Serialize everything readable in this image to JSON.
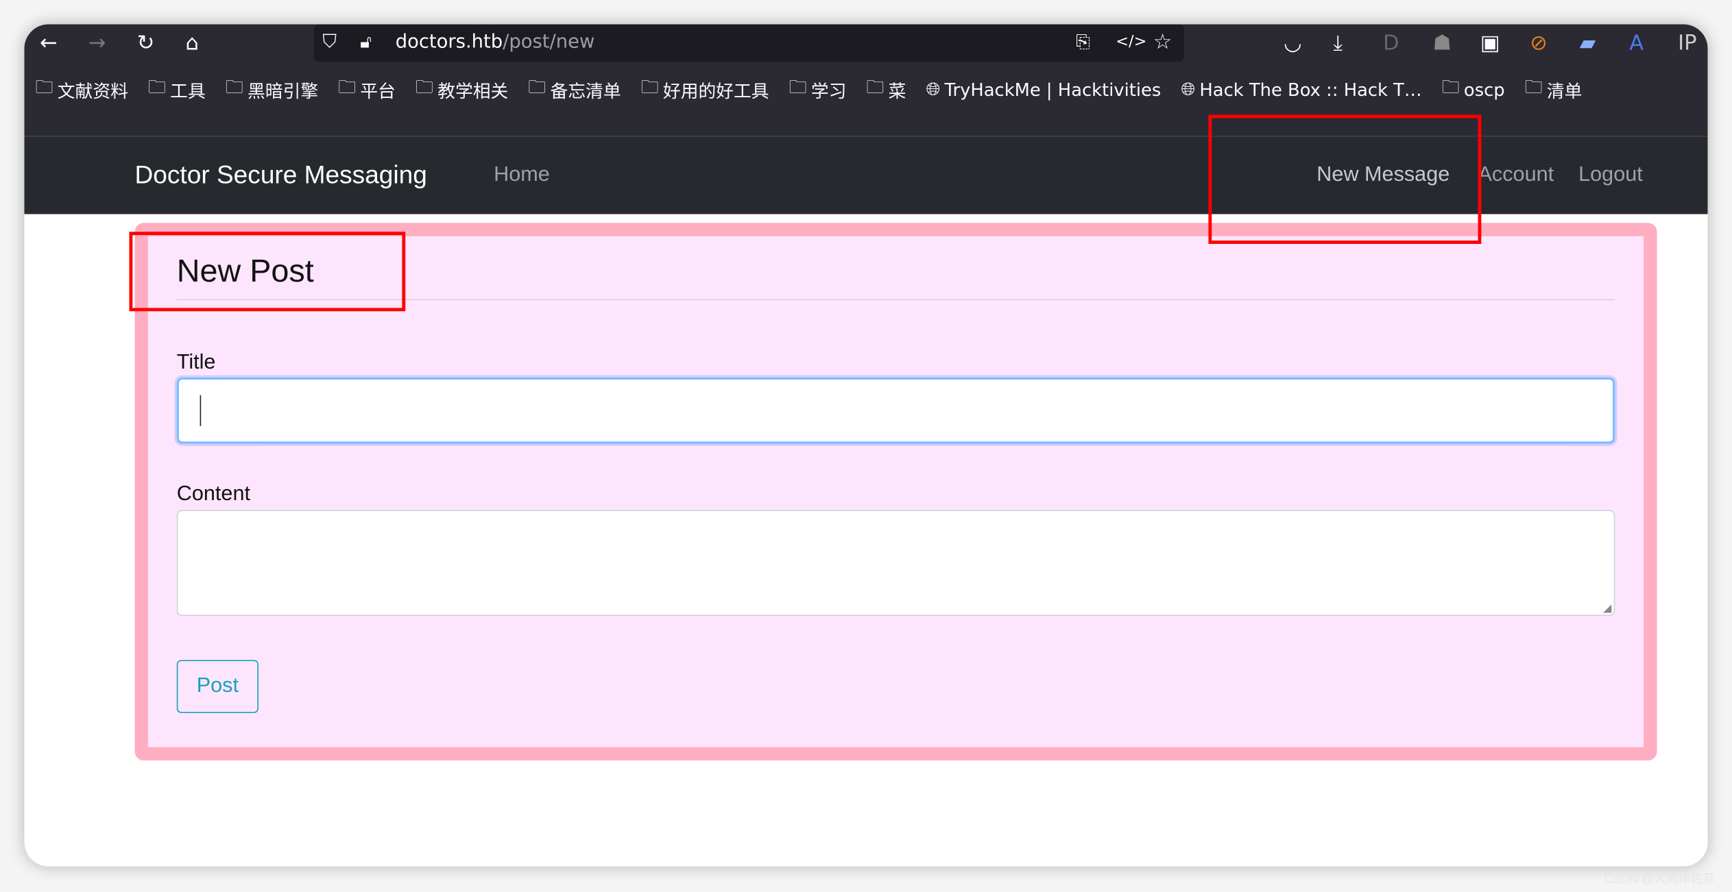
{
  "browser": {
    "url_host": "doctors.htb",
    "url_path": "/post/new",
    "bookmarks": [
      "文献资料",
      "工具",
      "黑暗引擎",
      "平台",
      "教学相关",
      "备忘清单",
      "好用的好工具",
      "学习",
      "菜",
      "TryHackMe | Hacktivities",
      "Hack The Box :: Hack T…",
      "oscp",
      "清单"
    ],
    "bookmark_icons": [
      "folder",
      "folder",
      "folder",
      "folder",
      "folder",
      "folder",
      "folder",
      "folder",
      "folder",
      "globe",
      "globe",
      "folder",
      "folder"
    ]
  },
  "navbar": {
    "brand": "Doctor Secure Messaging",
    "home": "Home",
    "new_message": "New Message",
    "account": "Account",
    "logout": "Logout"
  },
  "form": {
    "heading": "New Post",
    "title_label": "Title",
    "title_value": "",
    "content_label": "Content",
    "content_value": "",
    "submit": "Post"
  },
  "colors": {
    "card_bg": "#fde6fd",
    "card_border": "#ffaec2",
    "navbar": "#262a2f",
    "button": "#17a2b8",
    "highlight": "#ff0000"
  },
  "watermark": "CSDN @人间体佐菲"
}
